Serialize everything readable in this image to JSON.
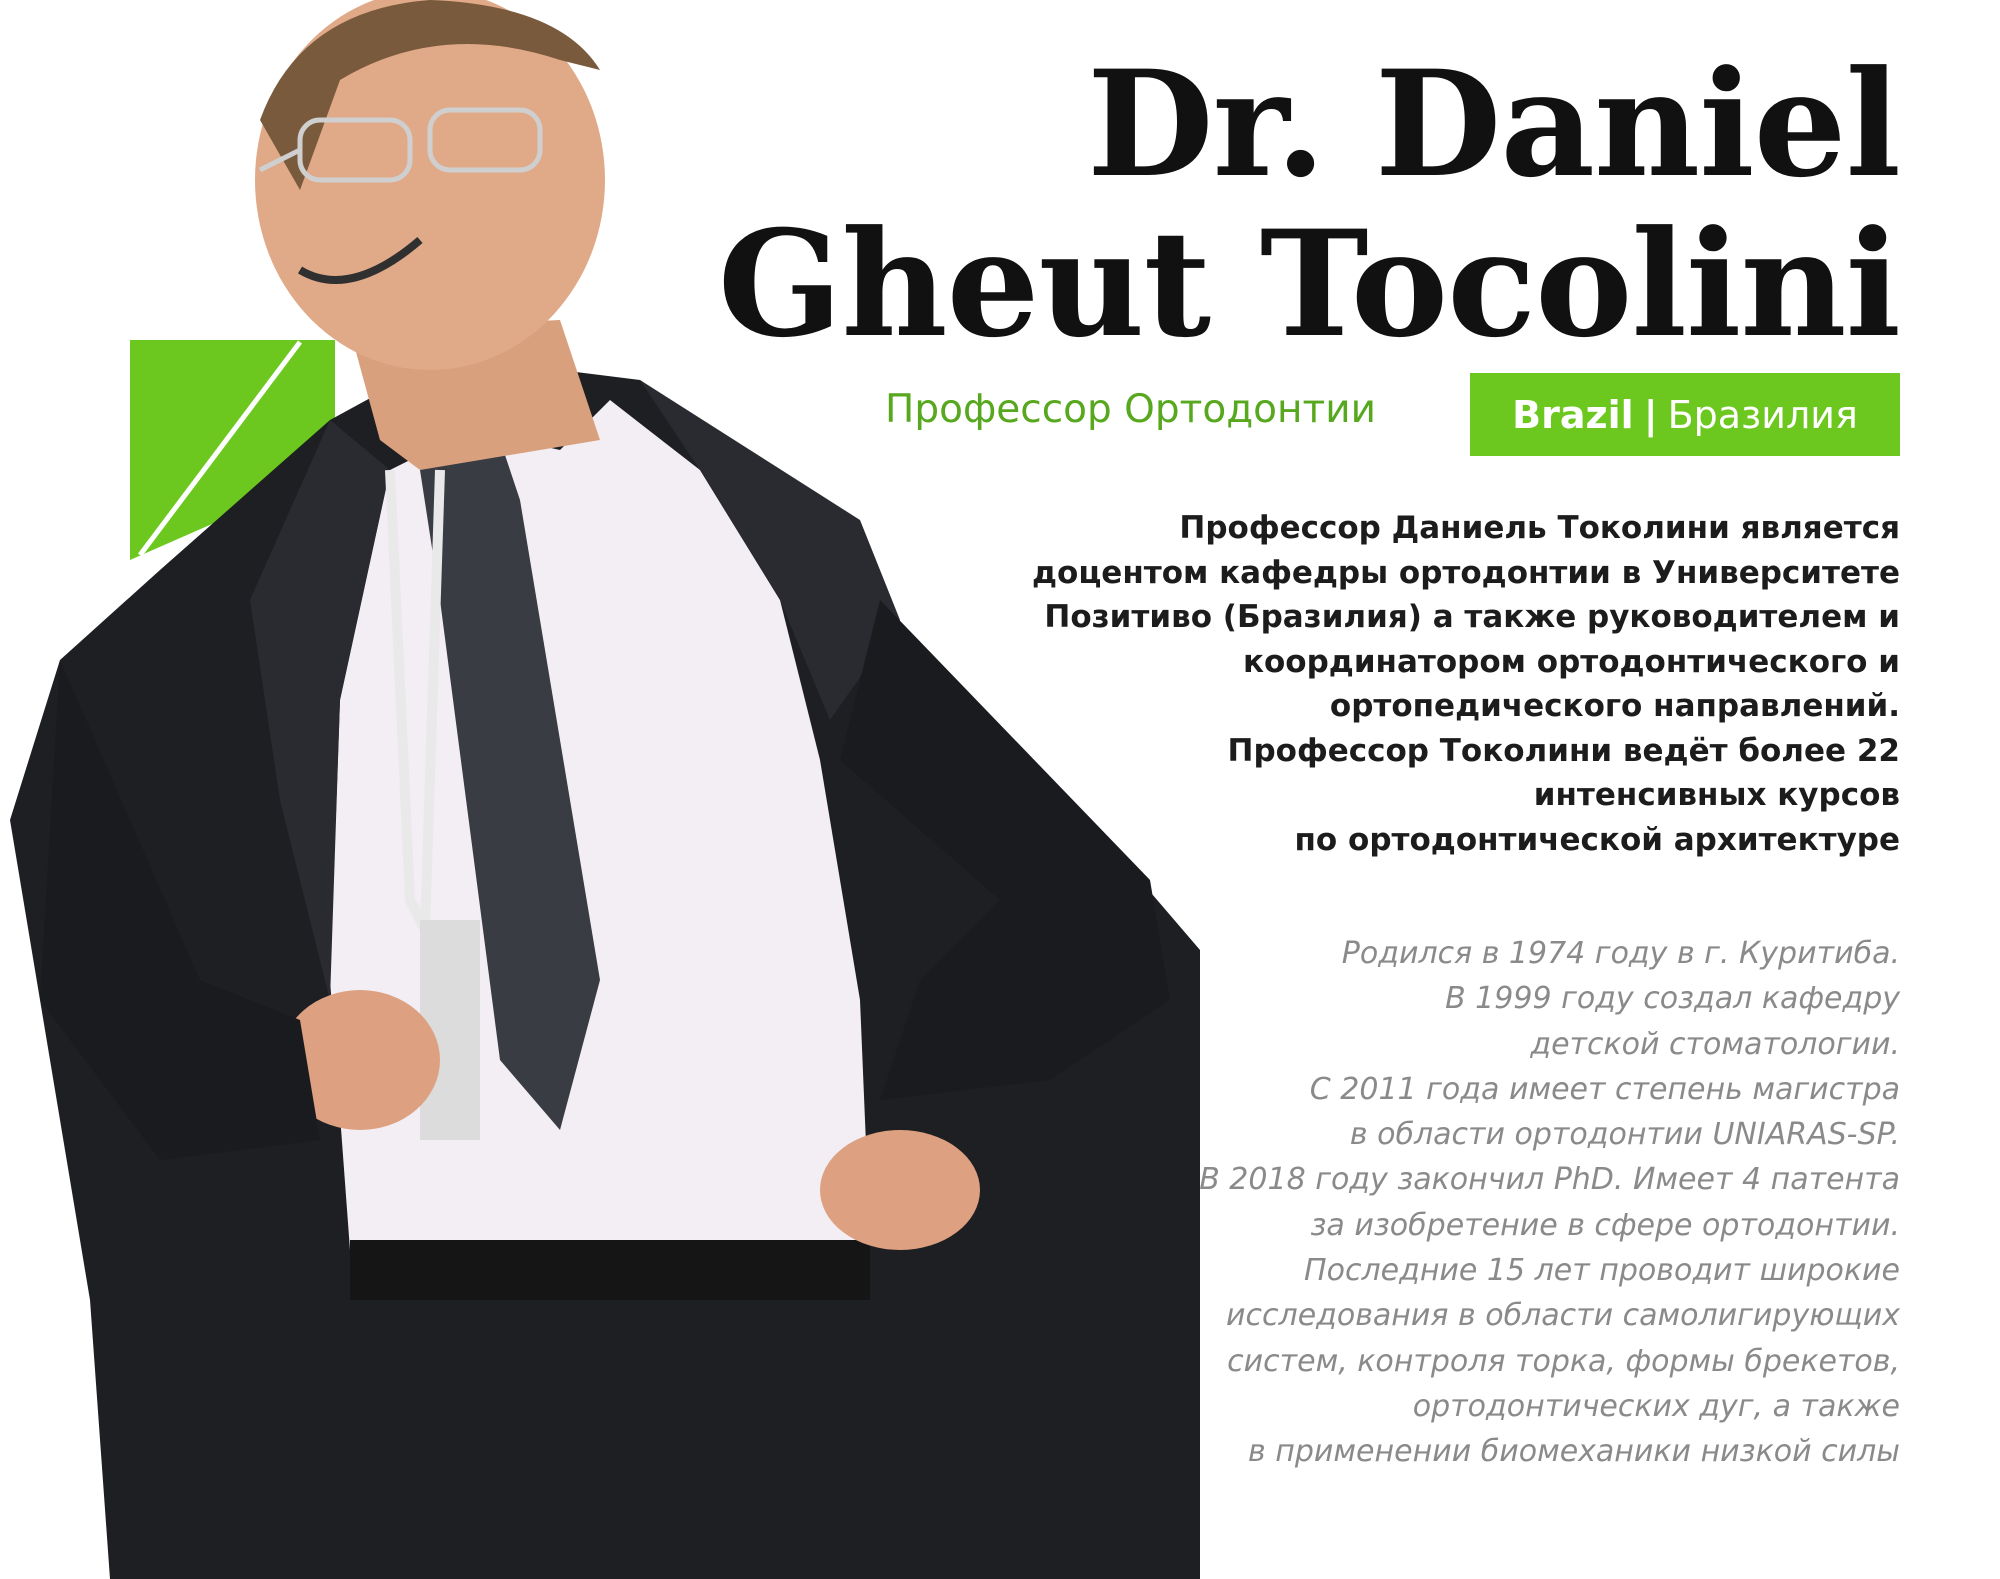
{
  "header": {
    "name_line1": "Dr. Daniel",
    "name_line2": "Gheut Tocolini"
  },
  "role": {
    "title": "Профессор Ортодонтии",
    "country_en": "Brazil",
    "separator": "|",
    "country_ru": "Бразилия"
  },
  "bio_lines": [
    "Профессор Даниель Токолини является",
    "доцентом кафедры ортодонтии в Университете",
    "Позитиво (Бразилия) а также руководителем и",
    "координатором ортодонтического и",
    "ортопедического направлений.",
    "Профессор Токолини ведёт более 22",
    "интенсивных курсов",
    "по ортодонтической архитектуре"
  ],
  "facts_lines": [
    "Родился в 1974 году в г. Куритиба.",
    "В 1999 году создал кафедру",
    "детской стоматологии.",
    "С 2011 года имеет степень магистра",
    "в области ортодонтии UNIARAS-SP.",
    "В 2018 году закончил PhD. Имеет 4 патента",
    "за изобретение в сфере ортодонтии.",
    "Последние 15 лет проводит широкие",
    "исследования в области самолигирующих",
    "систем, контроля торка, формы брекетов,",
    "ортодонтических дуг, а также",
    "в применении биомеханики низкой силы"
  ],
  "colors": {
    "accent_green": "#6cc81f",
    "role_green": "#57a81e",
    "title_black": "#111111",
    "bio_dark": "#1c1c1c",
    "facts_gray": "#8a8a8a"
  }
}
